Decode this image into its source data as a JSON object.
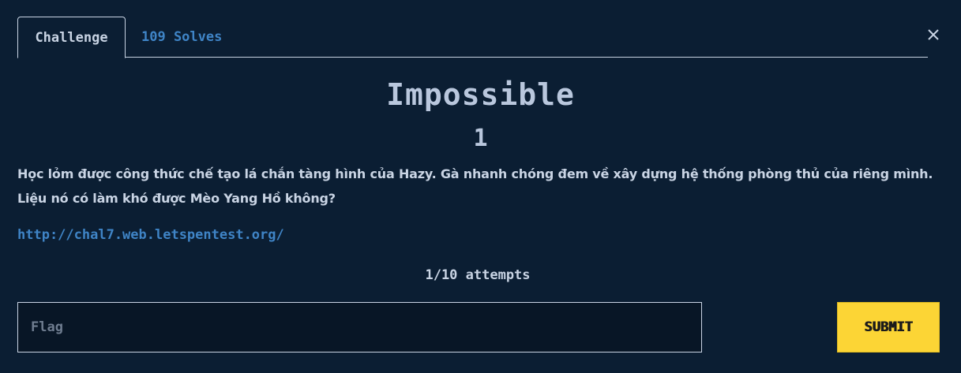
{
  "tabs": {
    "challenge_label": "Challenge",
    "solves_label": "109 Solves"
  },
  "close": {
    "icon": "close-icon"
  },
  "challenge": {
    "name": "Impossible",
    "value": "1",
    "description_line1": "Học lỏm được công thức chế tạo lá chắn tàng hình của Hazy. Gà nhanh chóng đem về xây dựng hệ thống phòng thủ của riêng mình.",
    "description_line2": "Liệu nó có làm khó được Mèo Yang Hồ không?",
    "link": "http://chal7.web.letspentest.org/",
    "attempts": "1/10 attempts"
  },
  "form": {
    "flag_placeholder": "Flag",
    "flag_value": "",
    "submit_label": "SUBMIT"
  },
  "colors": {
    "background": "#0b1e33",
    "text": "#c9d4e4",
    "link": "#3f84c6",
    "submit": "#fcd535"
  }
}
